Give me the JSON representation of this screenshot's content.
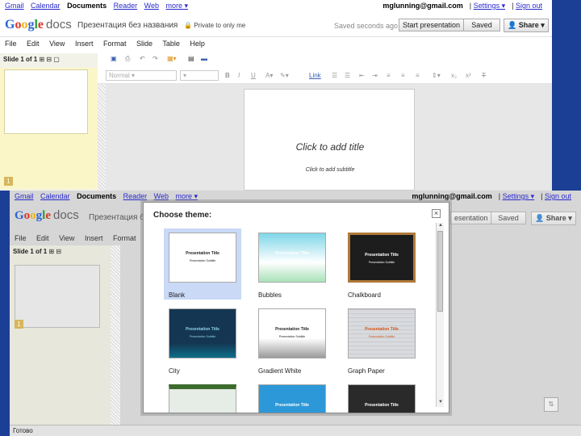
{
  "gbar": {
    "links": [
      "Gmail",
      "Calendar",
      "Documents",
      "Reader",
      "Web",
      "more ▾"
    ],
    "email": "mglunning@gmail.com",
    "settings": "Settings ▾",
    "signout": "Sign out",
    "sep": "|"
  },
  "header": {
    "logo_docs": "docs",
    "title": "Презентация без названия",
    "privacy": "Private to only me",
    "saved_msg": "Saved seconds ago",
    "start_btn": "Start presentation",
    "saved_btn": "Saved",
    "share_btn": "Share"
  },
  "menu": [
    "File",
    "Edit",
    "View",
    "Insert",
    "Format",
    "Slide",
    "Table",
    "Help"
  ],
  "sidebar": {
    "slide_count": "Slide 1 of 1",
    "thumb_num": "1"
  },
  "toolbar": {
    "font": "Normal",
    "size": "",
    "link": "Link"
  },
  "canvas": {
    "title": "Click to add title",
    "subtitle": "Click to add subtitle"
  },
  "front": {
    "title_partial": "Презентация б",
    "start_partial": "esentation",
    "status": "Готово"
  },
  "modal": {
    "title": "Choose theme:",
    "close": "×",
    "themes": [
      {
        "name": "Blank",
        "pt": "Presentation Title",
        "ps": "Presentation Subtitle",
        "bg": "#ffffff",
        "fg": "#222222",
        "selected": true
      },
      {
        "name": "Bubbles",
        "pt": "Presentation Title",
        "ps": "Presentation Subtitle",
        "bg": "#7fd6e8",
        "fg": "#ffffff",
        "selected": false
      },
      {
        "name": "Chalkboard",
        "pt": "Presentation Title",
        "ps": "Presentation Subtitle",
        "bg": "#1d1d1d",
        "fg": "#ffffff",
        "selected": false
      },
      {
        "name": "City",
        "pt": "Presentation Title",
        "ps": "Presentation Subtitle",
        "bg": "#143652",
        "fg": "#8fd0ea",
        "selected": false
      },
      {
        "name": "Gradient White",
        "pt": "Presentation Title",
        "ps": "Presentation Subtitle",
        "bg": "#ffffff",
        "fg": "#222222",
        "selected": false
      },
      {
        "name": "Graph Paper",
        "pt": "Presentation Title",
        "ps": "Presentation Subtitle",
        "bg": "#d8dadd",
        "fg": "#d4561a",
        "selected": false
      },
      {
        "name": "",
        "pt": "",
        "ps": "",
        "bg": "#e6ece6",
        "fg": "#222222",
        "selected": false
      },
      {
        "name": "",
        "pt": "Presentation Title",
        "ps": "",
        "bg": "#2d98d8",
        "fg": "#ffffff",
        "selected": false
      },
      {
        "name": "",
        "pt": "Presentation Title",
        "ps": "",
        "bg": "#2a2a2a",
        "fg": "#ffffff",
        "selected": false
      }
    ]
  }
}
